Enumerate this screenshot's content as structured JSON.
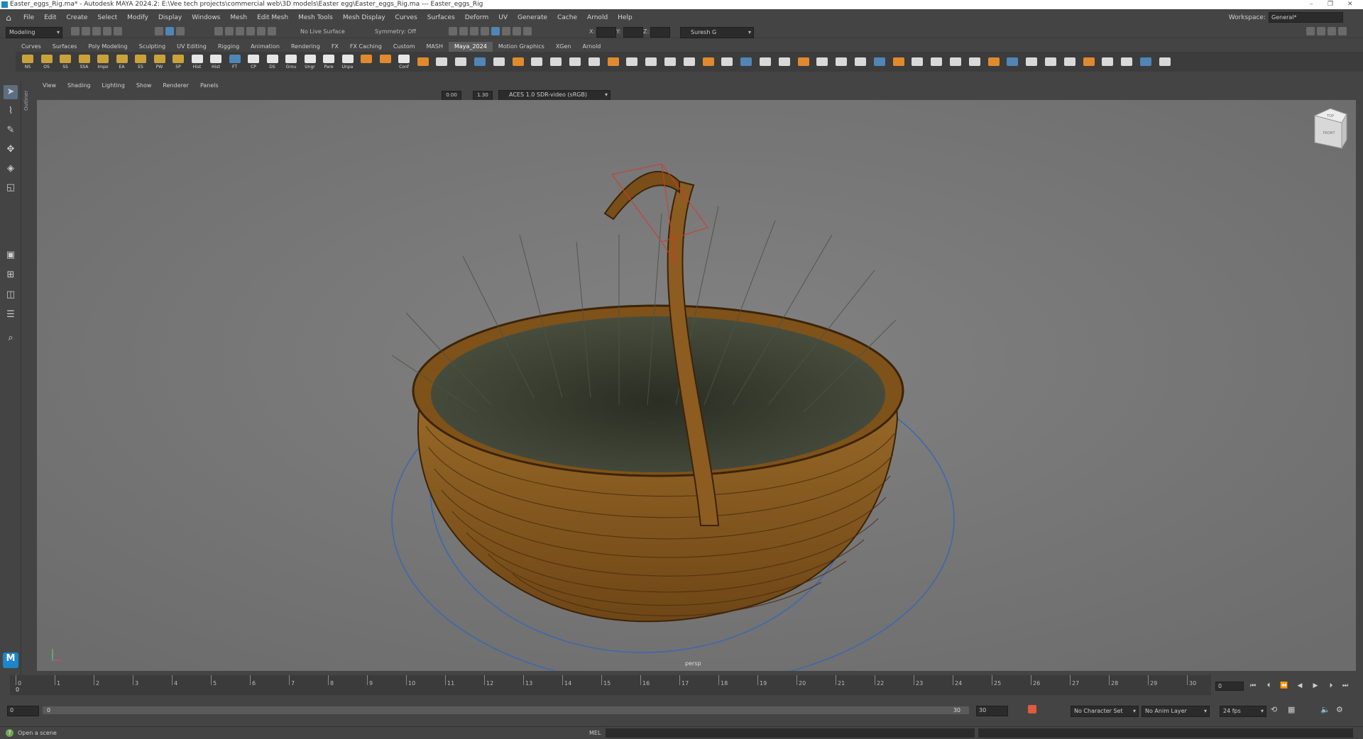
{
  "window": {
    "title": "Easter_eggs_Rig.ma* - Autodesk MAYA 2024.2: E:\\Vee tech projects\\commercial web\\3D models\\Easter egg\\Easter_eggs_Rig.ma  ---  Easter_eggs_Rig",
    "minimize": "–",
    "maximize": "❐",
    "close": "✕"
  },
  "menus": [
    "File",
    "Edit",
    "Create",
    "Select",
    "Modify",
    "Display",
    "Windows",
    "Mesh",
    "Edit Mesh",
    "Mesh Tools",
    "Mesh Display",
    "Curves",
    "Surfaces",
    "Deform",
    "UV",
    "Generate",
    "Cache",
    "Arnold",
    "Help"
  ],
  "workspace": {
    "label": "Workspace:",
    "value": "General*"
  },
  "status_line": {
    "mode": "Modeling",
    "live_surface": "No Live Surface",
    "symmetry": "Symmetry: Off",
    "x_label": "X:",
    "y_label": "Y:",
    "z_label": "Z:",
    "user": "Suresh G"
  },
  "shelf_tabs": [
    "Curves",
    "Surfaces",
    "Poly Modeling",
    "Sculpting",
    "UV Editing",
    "Rigging",
    "Animation",
    "Rendering",
    "FX",
    "FX Caching",
    "Custom",
    "MASH",
    "Maya_2024",
    "Motion Graphics",
    "XGen",
    "Arnold"
  ],
  "active_shelf": "Maya_2024",
  "shelf_labeled": [
    "NS",
    "OS",
    "SS",
    "SSA",
    "Impo",
    "EA",
    "ES",
    "PW",
    "SP",
    "Hist",
    "Hist",
    "FT",
    "CP",
    "DS",
    "Grou",
    "Ungr",
    "Pare",
    "Unpa",
    "",
    "",
    "Conf"
  ],
  "colors": {
    "folder": "#c9a23c",
    "white_icon": "#e6e6e6",
    "orange_icon": "#e08a2e",
    "accent": "#4f86b6",
    "basket": "#8a5a1f",
    "grass": "#2e3326",
    "locator": "#3a68b0",
    "handle_bbox": "#d43a2c"
  },
  "panel_menu": [
    "View",
    "Shading",
    "Lighting",
    "Show",
    "Renderer",
    "Panels"
  ],
  "panel_toolbar": {
    "exposure": "0.00",
    "gamma": "1.30",
    "colorspace": "ACES 1.0 SDR-video (sRGB)"
  },
  "outliner_label": "Outliner",
  "viewport": {
    "camera": "persp",
    "viewcube_top": "TOP",
    "viewcube_front": "FRONT"
  },
  "timeline": {
    "ticks": [
      0,
      1,
      2,
      3,
      4,
      5,
      6,
      7,
      8,
      9,
      10,
      11,
      12,
      13,
      14,
      15,
      16,
      17,
      18,
      19,
      20,
      21,
      22,
      23,
      24,
      25,
      26,
      27,
      28,
      29,
      30
    ],
    "current_frame": "0",
    "marker": "0"
  },
  "range": {
    "start": "0",
    "inner_start": "0",
    "inner_end": "30",
    "end": "30",
    "character_set": "No Character Set",
    "anim_layer": "No Anim Layer",
    "fps": "24 fps"
  },
  "command_line": {
    "help": "Open a scene",
    "lang": "MEL"
  },
  "logo": "M"
}
